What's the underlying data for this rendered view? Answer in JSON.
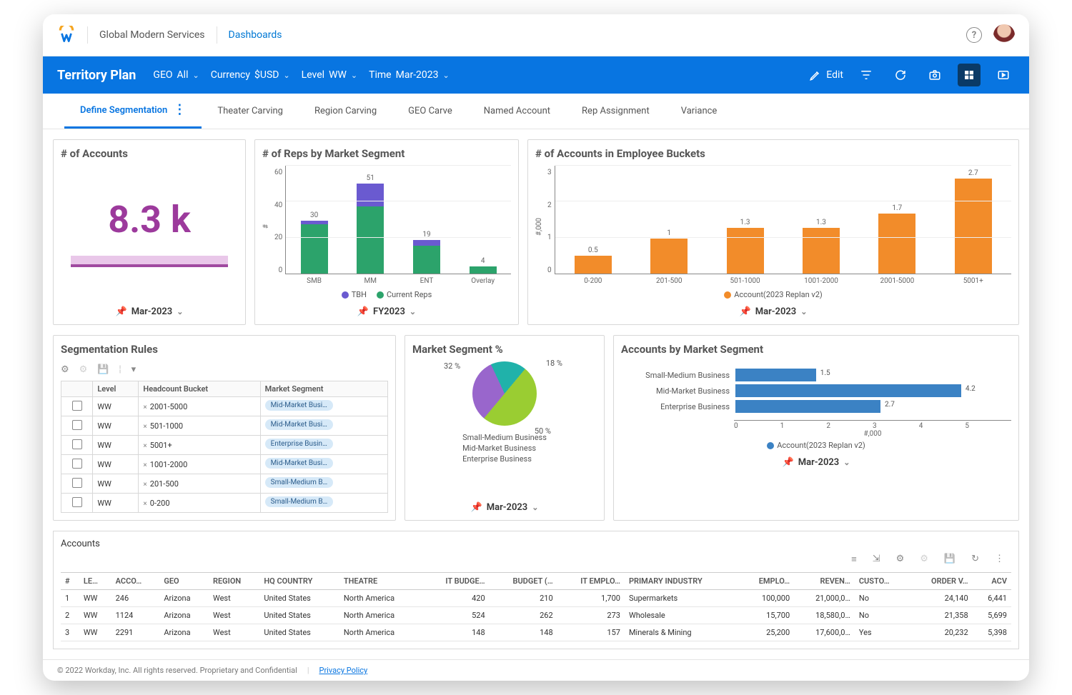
{
  "top": {
    "org": "Global Modern Services",
    "crumb": "Dashboards"
  },
  "bluebar": {
    "title": "Territory Plan",
    "filters": [
      {
        "label": "Time",
        "value": "Mar-2023"
      },
      {
        "label": "Level",
        "value": "WW"
      },
      {
        "label": "Currency",
        "value": "$USD"
      },
      {
        "label": "GEO",
        "value": "All"
      }
    ],
    "edit": "Edit"
  },
  "tabs": [
    "Define Segmentation",
    "Theater Carving",
    "Region Carving",
    "GEO Carve",
    "Named Account",
    "Rep Assignment",
    "Variance"
  ],
  "cards": {
    "kpi": {
      "title": "# of Accounts",
      "value": "8.3 k",
      "pin": "Mar-2023"
    },
    "reps": {
      "title": "# of Reps by Market Segment",
      "pin": "FY2023"
    },
    "buckets": {
      "title": "# of Accounts in Employee Buckets",
      "pin": "Mar-2023"
    },
    "rules": {
      "title": "Segmentation Rules"
    },
    "segpct": {
      "title": "Market Segment %",
      "pin": "Mar-2023"
    },
    "acctseg": {
      "title": "Accounts by Market Segment",
      "pin": "Mar-2023"
    },
    "accounts": {
      "title": "Accounts"
    }
  },
  "chart_data": [
    {
      "id": "reps",
      "type": "bar",
      "stacked": true,
      "categories": [
        "SMB",
        "MM",
        "ENT",
        "Overlay"
      ],
      "series": [
        {
          "name": "Current Reps",
          "color": "#2ca36b",
          "values": [
            28,
            38,
            16,
            4
          ]
        },
        {
          "name": "TBH",
          "color": "#6a5ad0",
          "values": [
            2,
            13,
            3,
            0
          ]
        }
      ],
      "totals": [
        30,
        51,
        19,
        4
      ],
      "ylabel": "#",
      "ylim": [
        0,
        60
      ],
      "yticks": [
        0,
        20,
        40,
        60
      ],
      "legend": [
        "TBH",
        "Current Reps"
      ]
    },
    {
      "id": "buckets",
      "type": "bar",
      "categories": [
        "0-200",
        "201-500",
        "501-1000",
        "1001-2000",
        "2001-5000",
        "5001+"
      ],
      "values": [
        0.5,
        1.0,
        1.3,
        1.3,
        1.7,
        2.7
      ],
      "ylabel": "#,000",
      "ylim": [
        0,
        3
      ],
      "yticks": [
        0,
        1,
        2,
        3
      ],
      "legend_single": "Account(2023 Replan v2)",
      "color": "#f28c2a"
    },
    {
      "id": "segpct",
      "type": "pie",
      "slices": [
        {
          "name": "Small-Medium Business",
          "value": 18,
          "color": "#20b2aa"
        },
        {
          "name": "Mid-Market Business",
          "value": 50,
          "color": "#9acd32"
        },
        {
          "name": "Enterprise Business",
          "value": 32,
          "color": "#9966cc"
        }
      ]
    },
    {
      "id": "acctseg",
      "type": "bar",
      "orientation": "horizontal",
      "categories": [
        "Small-Medium Business",
        "Mid-Market Business",
        "Enterprise Business"
      ],
      "values": [
        1.5,
        4.2,
        2.7
      ],
      "xlabel": "#,000",
      "xlim": [
        0,
        5
      ],
      "xticks": [
        0,
        1,
        2,
        3,
        4,
        5
      ],
      "legend_single": "Account(2023 Replan v2)",
      "color": "#3b82c4"
    }
  ],
  "rules": {
    "headers": [
      "",
      "Level",
      "Headcount Bucket",
      "Market Segment"
    ],
    "rows": [
      {
        "level": "WW",
        "bucket": "2001-5000",
        "segment": "Mid-Market Busi…"
      },
      {
        "level": "WW",
        "bucket": "501-1000",
        "segment": "Mid-Market Busi…"
      },
      {
        "level": "WW",
        "bucket": "5001+",
        "segment": "Enterprise Busin…"
      },
      {
        "level": "WW",
        "bucket": "1001-2000",
        "segment": "Mid-Market Busi…"
      },
      {
        "level": "WW",
        "bucket": "201-500",
        "segment": "Small-Medium B…"
      },
      {
        "level": "WW",
        "bucket": "0-200",
        "segment": "Small-Medium B…"
      }
    ]
  },
  "accounts": {
    "headers": [
      "#",
      "LE…",
      "ACCO…",
      "GEO",
      "REGION",
      "HQ COUNTRY",
      "THEATRE",
      "IT BUDGE…",
      "BUDGET (…",
      "IT EMPLO…",
      "PRIMARY INDUSTRY",
      "EMPLO…",
      "REVEN…",
      "CUSTO…",
      "ORDER V…",
      "ACV"
    ],
    "rows": [
      {
        "n": 1,
        "le": "WW",
        "acct": "246",
        "geo": "Arizona",
        "region": "West",
        "hq": "United States",
        "theatre": "North America",
        "itb": "420",
        "budget": "210",
        "itemp": "1,700",
        "ind": "Supermarkets",
        "emp": "100,000",
        "rev": "21,000,0…",
        "cust": "No",
        "orderv": "24,140",
        "acv": "6,441"
      },
      {
        "n": 2,
        "le": "WW",
        "acct": "1124",
        "geo": "Arizona",
        "region": "West",
        "hq": "United States",
        "theatre": "North America",
        "itb": "524",
        "budget": "262",
        "itemp": "273",
        "ind": "Wholesale",
        "emp": "15,700",
        "rev": "18,580,0…",
        "cust": "No",
        "orderv": "21,358",
        "acv": "5,699"
      },
      {
        "n": 3,
        "le": "WW",
        "acct": "2291",
        "geo": "Arizona",
        "region": "West",
        "hq": "United States",
        "theatre": "North America",
        "itb": "148",
        "budget": "148",
        "itemp": "157",
        "ind": "Minerals & Mining",
        "emp": "25,200",
        "rev": "17,600,0…",
        "cust": "Yes",
        "orderv": "20,232",
        "acv": "5,398"
      }
    ]
  },
  "footer": {
    "copyright": "© 2022 Workday, Inc. All rights reserved. Proprietary and Confidential",
    "privacy": "Privacy Policy"
  }
}
